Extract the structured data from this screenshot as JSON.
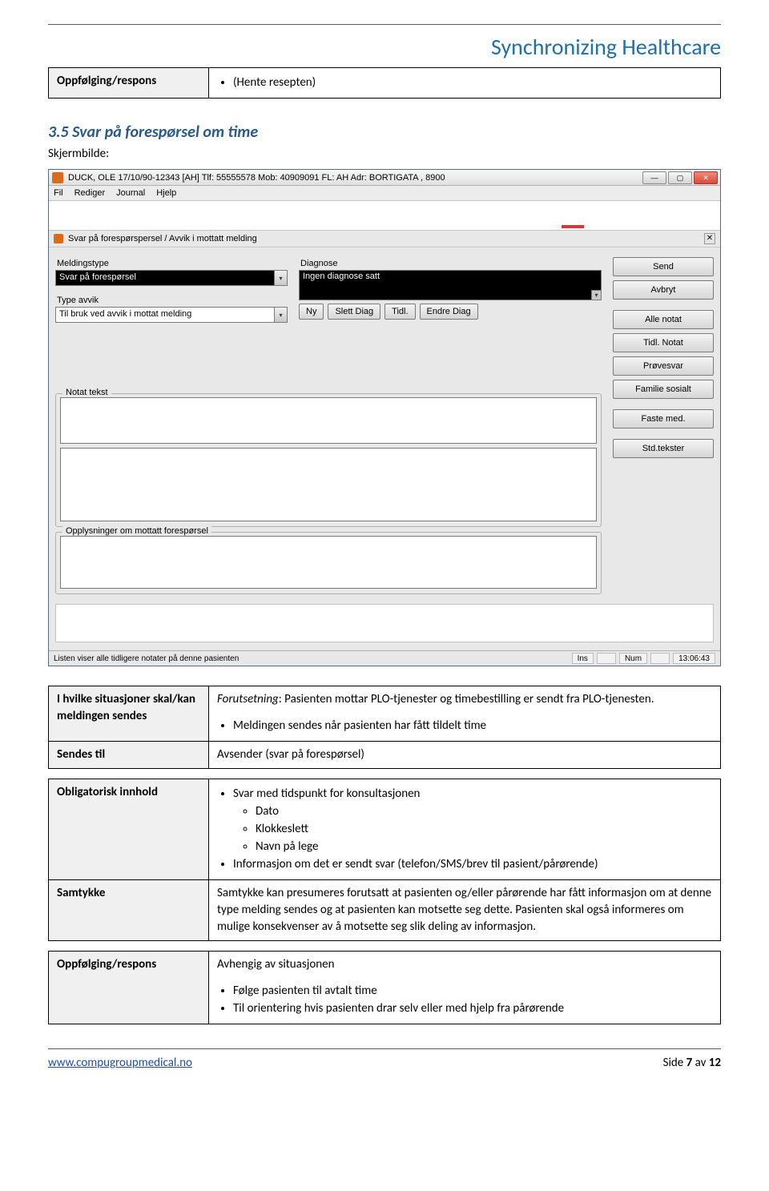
{
  "header": {
    "title": "Synchronizing Healthcare"
  },
  "top_table": {
    "label": "Oppfølging/respons",
    "value": "(Hente resepten)"
  },
  "section": {
    "heading": "3.5 Svar på forespørsel om time",
    "caption": "Skjermbilde:"
  },
  "app": {
    "title": "DUCK, OLE 17/10/90-12343 [AH] Tlf: 55555578 Mob: 40909091 FL: AH Adr: BORTIGATA , 8900",
    "menu": [
      "Fil",
      "Rediger",
      "Journal",
      "Hjelp"
    ],
    "panel_title": "Svar på forespørspersel / Avvik i mottatt melding",
    "meldingstype_label": "Meldingstype",
    "meldingstype_value": "Svar på forespørsel",
    "typeavvik_label": "Type avvik",
    "typeavvik_value": "Til bruk ved avvik i mottat melding",
    "diagnose_label": "Diagnose",
    "diagnose_value": "Ingen diagnose satt",
    "btn_ny": "Ny",
    "btn_slett": "Slett Diag",
    "btn_tidl": "Tidl.",
    "btn_endre": "Endre Diag",
    "notat_legend": "Notat tekst",
    "oppl_legend": "Opplysninger om mottatt forespørsel",
    "side": {
      "send": "Send",
      "avbryt": "Avbryt",
      "alle_notat": "Alle notat",
      "tidl_notat": "Tidl. Notat",
      "provesvar": "Prøvesvar",
      "familie": "Familie sosialt",
      "faste": "Faste med.",
      "std": "Std.tekster"
    },
    "status_left": "Listen viser alle tidligere notater på denne pasienten",
    "status_ins": "Ins",
    "status_num": "Num",
    "status_time": "13:06:43"
  },
  "main_table": {
    "row1_label": "I hvilke situasjoner skal/kan meldingen sendes",
    "row1_intro_prefix": "Forutsetning",
    "row1_intro_rest": ": Pasienten mottar PLO-tjenester og timebestilling er sendt fra PLO-tjenesten.",
    "row1_bullet": "Meldingen sendes når pasienten har fått tildelt time",
    "row2_label": "Sendes til",
    "row2_value": "Avsender (svar på forespørsel)",
    "row3_label": "Obligatorisk innhold",
    "row3_b1": "Svar med tidspunkt for konsultasjonen",
    "row3_sub1": "Dato",
    "row3_sub2": "Klokkeslett",
    "row3_sub3": "Navn på lege",
    "row3_b2": "Informasjon om det er sendt svar (telefon/SMS/brev til pasient/pårørende)",
    "row4_label": "Samtykke",
    "row4_value": "Samtykke kan presumeres forutsatt at pasienten og/eller pårørende har fått informasjon om at denne type melding sendes og at pasienten kan motsette seg dette. Pasienten skal også informeres om mulige konsekvenser av å motsette seg slik deling av informasjon.",
    "row5_label": "Oppfølging/respons",
    "row5_intro": "Avhengig av situasjonen",
    "row5_b1": "Følge pasienten til avtalt time",
    "row5_b2": "Til orientering hvis pasienten drar selv eller med hjelp fra pårørende"
  },
  "footer": {
    "link": "www.compugroupmedical.no",
    "page_prefix": "Side ",
    "page_num": "7",
    "page_mid": " av ",
    "page_total": "12"
  }
}
